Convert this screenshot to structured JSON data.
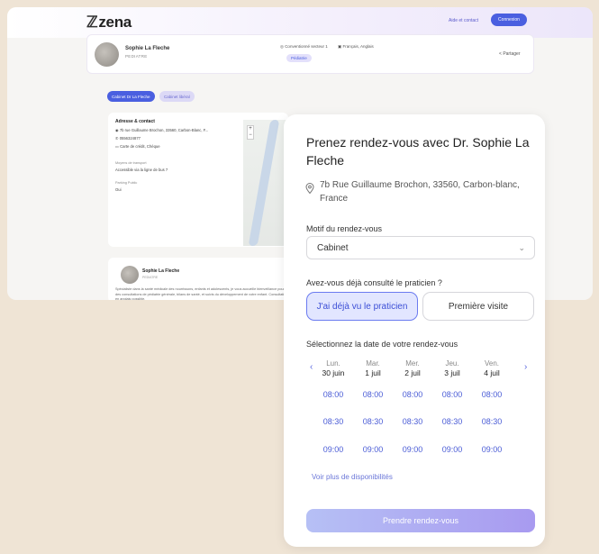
{
  "app": {
    "logo": "zena",
    "help_link": "Aide et contact",
    "connect_label": "Connexion"
  },
  "doctor": {
    "name": "Sophie La Fleche",
    "specialty": "PEDIATRE",
    "convention": "Conventionné secteur 1",
    "languages": "Français, Anglais",
    "tag": "Pédiatrie",
    "share_label": "Partager"
  },
  "tabs": [
    {
      "label": "Cabinet Dr La Fleche"
    },
    {
      "label": "Cabinet libéral"
    }
  ],
  "address_card": {
    "title": "Adresse & contact",
    "address": "7b rue Guillaume Brochon, 33560, Carbon-Blanc, F...",
    "phone": "0556324877",
    "payment": "Carte de crédit, Chèque",
    "transport_label": "Moyens de transport",
    "transport_value": "Accessible via la ligne de bus 7",
    "parking_label": "Parking Public",
    "parking_value": "Oui"
  },
  "bio_card": {
    "name": "Sophie La Fleche",
    "specialty": "PEDIATRE",
    "text": "Spécialiste dans la santé médicale des nourrissons, enfants et adolescents, je vous accueille bienveillance pour des consultations de pédiatrie générale, bilans de santé, et suivis du développement de votre enfant. Consultation en anglais possible."
  },
  "booking": {
    "title": "Prenez rendez-vous avec Dr. Sophie La Fleche",
    "address": "7b Rue Guillaume Brochon, 33560, Carbon-blanc, France",
    "motif_label": "Motif du rendez-vous",
    "motif_value": "Cabinet",
    "consulted_label": "Avez-vous déjà consulté le praticien ?",
    "option_1": "J'ai déjà vu le praticien",
    "option_2": "Première visite",
    "date_label": "Sélectionnez la date de votre rendez-vous",
    "prev_icon": "‹",
    "next_icon": "›",
    "days": [
      {
        "dow": "Lun.",
        "date": "30 juin"
      },
      {
        "dow": "Mar.",
        "date": "1 juil"
      },
      {
        "dow": "Mer.",
        "date": "2 juil"
      },
      {
        "dow": "Jeu.",
        "date": "3 juil"
      },
      {
        "dow": "Ven.",
        "date": "4 juil"
      }
    ],
    "slots": [
      "08:00",
      "08:30",
      "09:00"
    ],
    "more_link": "Voir plus de disponibilités",
    "cta_label": "Prendre rendez-vous"
  },
  "colors": {
    "accent": "#4a5fe0",
    "background": "#efe4d5"
  }
}
